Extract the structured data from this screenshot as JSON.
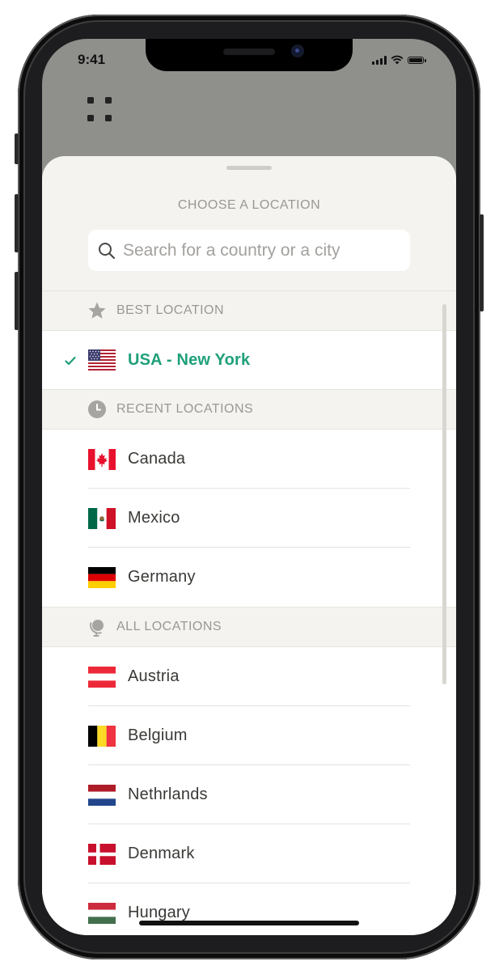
{
  "status_bar": {
    "time": "9:41"
  },
  "sheet": {
    "title": "CHOOSE A LOCATION",
    "search": {
      "placeholder": "Search for a country or a city",
      "value": ""
    }
  },
  "sections": {
    "best": {
      "label": "BEST LOCATION",
      "icon": "star-icon"
    },
    "recent": {
      "label": "RECENT LOCATIONS",
      "icon": "clock-icon"
    },
    "all": {
      "label": "ALL LOCATIONS",
      "icon": "globe-icon"
    }
  },
  "best_location": {
    "label": "USA - New York",
    "selected": true,
    "flag": "flag-usa-icon"
  },
  "recent_locations": [
    {
      "label": "Canada",
      "flag": "flag-canada-icon"
    },
    {
      "label": "Mexico",
      "flag": "flag-mexico-icon"
    },
    {
      "label": "Germany",
      "flag": "flag-germany-icon"
    }
  ],
  "all_locations": [
    {
      "label": "Austria",
      "flag": "flag-austria-icon"
    },
    {
      "label": "Belgium",
      "flag": "flag-belgium-icon"
    },
    {
      "label": "Nethrlands",
      "flag": "flag-netherlands-icon"
    },
    {
      "label": "Denmark",
      "flag": "flag-denmark-icon"
    },
    {
      "label": "Hungary",
      "flag": "flag-hungary-icon"
    }
  ],
  "colors": {
    "accent_green": "#1fa07a",
    "sheet_bg": "#f4f3ef",
    "backdrop": "#8f8f8c",
    "muted_text": "#9a9894"
  }
}
